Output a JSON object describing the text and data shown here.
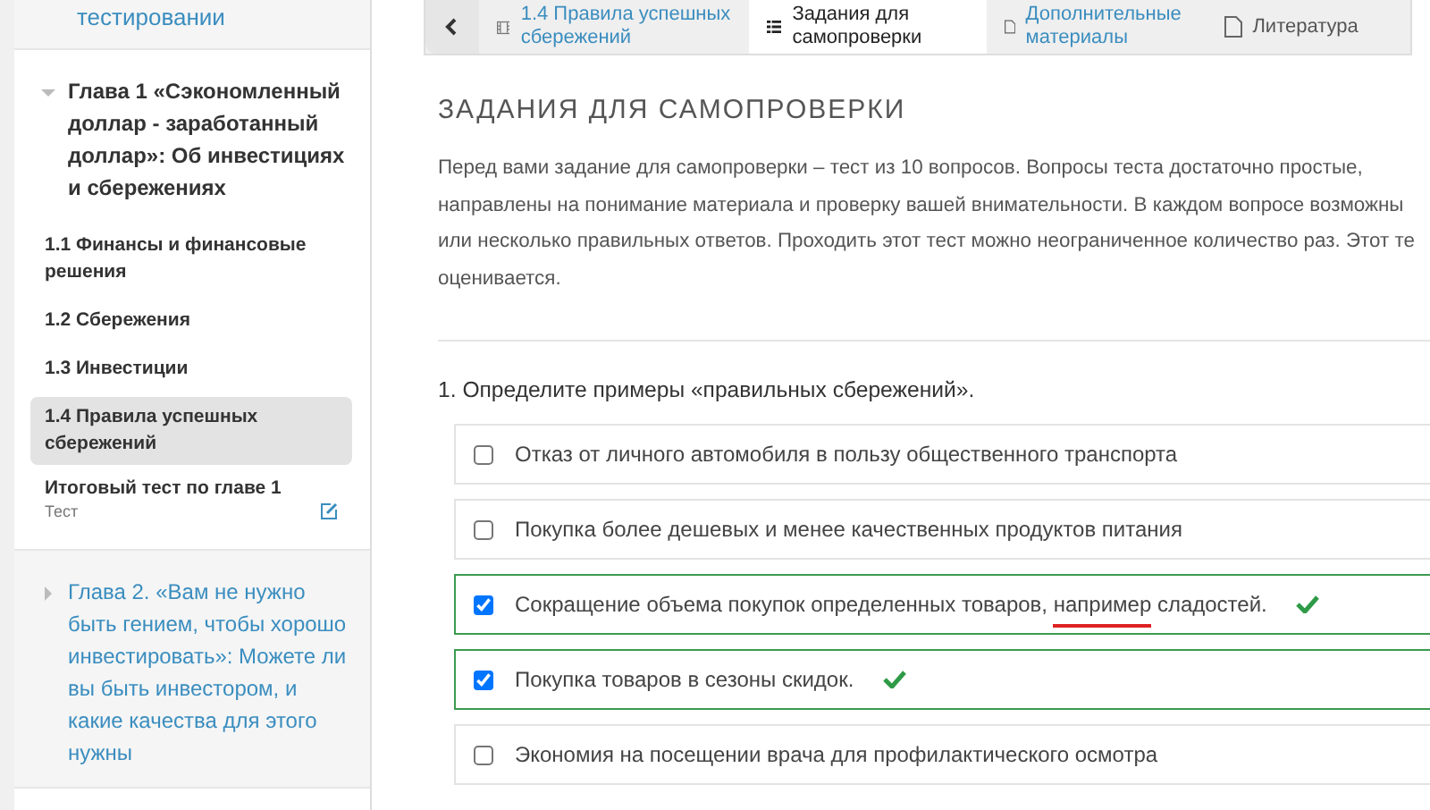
{
  "sidebar": {
    "top_item": {
      "text": "тестировании"
    },
    "chapters": [
      {
        "title": "Глава 1 «Сэкономленный доллар - заработанный доллар»: Об инвестициях и сбережениях",
        "expanded": true,
        "items": [
          {
            "kind": "lesson",
            "title": "1.1 Финансы и финансовые решения",
            "selected": false
          },
          {
            "kind": "lesson",
            "title": "1.2 Сбережения",
            "selected": false
          },
          {
            "kind": "lesson",
            "title": "1.3 Инвестиции",
            "selected": false
          },
          {
            "kind": "lesson",
            "title": "1.4 Правила успешных сбережений",
            "selected": true
          },
          {
            "kind": "test",
            "title": "Итоговый тест по главе 1",
            "subtitle": "Тест",
            "selected": false
          }
        ]
      },
      {
        "title": "Глава 2. «Вам не нужно быть гением, чтобы хорошо инвестировать»: Можете ли вы быть инвестором, и какие качества для этого нужны",
        "expanded": false
      }
    ]
  },
  "tabs": [
    {
      "kind": "lesson",
      "label": "1.4 Правила успешных сбережений",
      "selected": false,
      "link": true
    },
    {
      "kind": "quiz",
      "label": "Задания для самопроверки",
      "selected": true,
      "link": false
    },
    {
      "kind": "file",
      "label": "Дополнительные материалы",
      "selected": false,
      "link": true
    },
    {
      "kind": "file",
      "label": "Литература",
      "selected": false,
      "link": false
    }
  ],
  "heading": "ЗАДАНИЯ ДЛЯ САМОПРОВЕРКИ",
  "intro_lines": [
    "Перед вами задание для самопроверки – тест из 10 вопросов. Вопросы теста достаточно простые,",
    "направлены на понимание материала и проверку вашей внимательности. В каждом вопросе возможны",
    "или несколько правильных ответов. Проходить этот тест можно неограниченное количество раз. Этот те",
    "оценивается."
  ],
  "question": {
    "number": "1.",
    "text": "Определите примеры «правильных сбережений».",
    "options": [
      {
        "parts": [
          {
            "text": "Отказ от личного автомобиля в пользу общественного транспорта",
            "underlined": false
          }
        ],
        "checked": false,
        "correct": false
      },
      {
        "parts": [
          {
            "text": "Покупка более дешевых и менее качественных продуктов питания",
            "underlined": false
          }
        ],
        "checked": false,
        "correct": false
      },
      {
        "parts": [
          {
            "text": "Сокращение объема покупок определенных товаров, ",
            "underlined": false
          },
          {
            "text": "например",
            "underlined": true
          },
          {
            "text": " сладостей.",
            "underlined": false
          }
        ],
        "checked": true,
        "correct": true
      },
      {
        "parts": [
          {
            "text": "Покупка товаров в сезоны скидок.",
            "underlined": false
          }
        ],
        "checked": true,
        "correct": true
      },
      {
        "parts": [
          {
            "text": "Экономия на посещении врача для профилактического осмотра",
            "underlined": false
          }
        ],
        "checked": false,
        "correct": false
      }
    ]
  }
}
